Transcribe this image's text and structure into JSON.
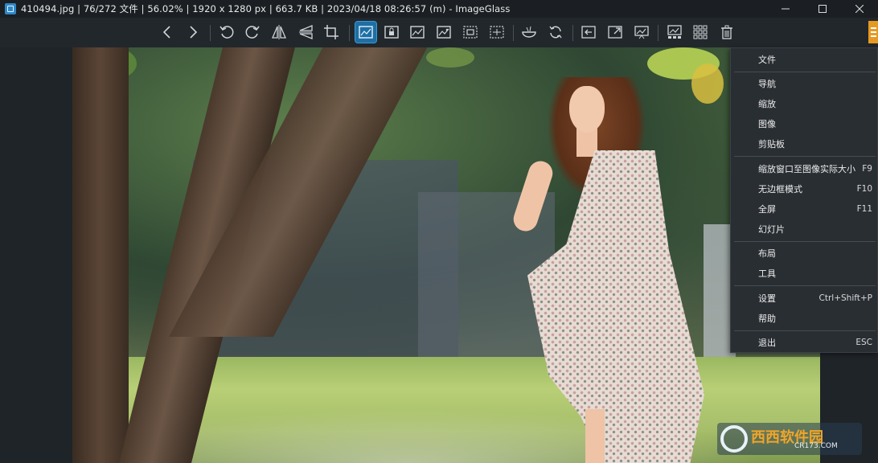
{
  "titlebar": {
    "title": "410494.jpg  |  76/272 文件  |  56.02%  |  1920 x 1280 px  |  663.7 KB  |  2023/04/18 08:26:57 (m)  - ImageGlass",
    "app_icon": "imageglass-icon",
    "buttons": [
      "minimize-icon",
      "maximize-icon",
      "close-icon"
    ]
  },
  "toolbar": {
    "buttons": [
      {
        "name": "previous-image-button",
        "icon": "chevron-left-icon"
      },
      {
        "name": "next-image-button",
        "icon": "chevron-right-icon"
      },
      {
        "name": "rotate-left-button",
        "icon": "rotate-left-icon"
      },
      {
        "name": "rotate-right-button",
        "icon": "rotate-right-icon"
      },
      {
        "name": "flip-horizontal-button",
        "icon": "flip-horizontal-icon"
      },
      {
        "name": "flip-vertical-button",
        "icon": "flip-vertical-icon"
      },
      {
        "name": "crop-button",
        "icon": "crop-icon"
      },
      {
        "name": "zoom-auto-button",
        "icon": "image-auto-icon",
        "active": true
      },
      {
        "name": "lock-zoom-button",
        "icon": "image-lock-icon"
      },
      {
        "name": "scale-to-width-button",
        "icon": "scale-width-icon"
      },
      {
        "name": "scale-to-height-button",
        "icon": "scale-height-icon"
      },
      {
        "name": "scale-to-fit-button",
        "icon": "scale-fit-icon"
      },
      {
        "name": "scale-to-fill-button",
        "icon": "scale-fill-icon"
      },
      {
        "name": "checkerboard-button",
        "icon": "bowl-icon"
      },
      {
        "name": "refresh-button",
        "icon": "refresh-icon"
      },
      {
        "name": "goto-image-button",
        "icon": "goto-icon"
      },
      {
        "name": "fullscreen-button",
        "icon": "expand-icon"
      },
      {
        "name": "slideshow-button",
        "icon": "slideshow-icon"
      },
      {
        "name": "thumbnail-bar-button",
        "icon": "thumbnail-icon"
      },
      {
        "name": "gallery-button",
        "icon": "grid-icon"
      },
      {
        "name": "delete-button",
        "icon": "trash-icon"
      }
    ],
    "menu_toggle": "hamburger-menu-icon",
    "accent": "#e79a22",
    "active_color": "#1d6fa5"
  },
  "menu": {
    "items": [
      {
        "label": "文件",
        "shortcut": ""
      },
      {
        "label": "导航",
        "shortcut": ""
      },
      {
        "label": "缩放",
        "shortcut": ""
      },
      {
        "label": "图像",
        "shortcut": ""
      },
      {
        "label": "剪贴板",
        "shortcut": ""
      },
      {
        "label": "缩放窗口至图像实际大小",
        "shortcut": "F9"
      },
      {
        "label": "无边框模式",
        "shortcut": "F10"
      },
      {
        "label": "全屏",
        "shortcut": "F11"
      },
      {
        "label": "幻灯片",
        "shortcut": ""
      },
      {
        "label": "布局",
        "shortcut": ""
      },
      {
        "label": "工具",
        "shortcut": ""
      },
      {
        "label": "设置",
        "shortcut": "Ctrl+Shift+P"
      },
      {
        "label": "帮助",
        "shortcut": ""
      },
      {
        "label": "退出",
        "shortcut": "ESC"
      }
    ]
  },
  "watermark": {
    "main": "西西软件园",
    "sub": "CR173.COM"
  }
}
